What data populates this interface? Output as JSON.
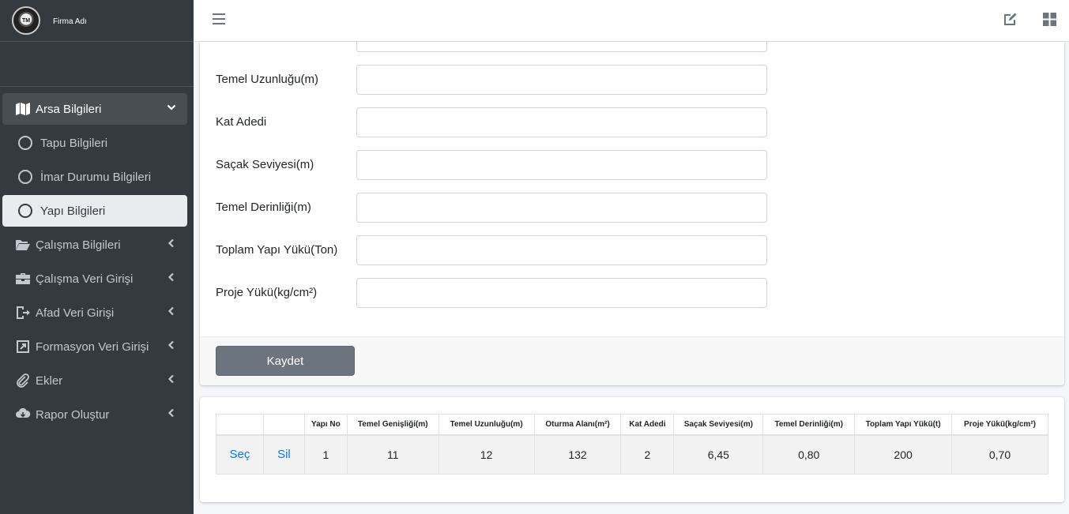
{
  "brand": {
    "name": "Firma Adı",
    "logo_text": "TM"
  },
  "sidebar": {
    "items": [
      {
        "label": "Arsa Bilgileri",
        "icon": "map-icon",
        "open": true
      },
      {
        "label": "Çalışma Bilgileri",
        "icon": "folder-open-icon"
      },
      {
        "label": "Çalışma Veri Girişi",
        "icon": "briefcase-icon"
      },
      {
        "label": "Afad Veri Girişi",
        "icon": "door-exit-icon"
      },
      {
        "label": "Formasyon Veri Girişi",
        "icon": "external-square-icon"
      },
      {
        "label": "Ekler",
        "icon": "paperclip-icon"
      },
      {
        "label": "Rapor Oluştur",
        "icon": "cloud-download-icon"
      }
    ],
    "subitems": [
      {
        "label": "Tapu Bilgileri"
      },
      {
        "label": "İmar Durumu Bilgileri"
      },
      {
        "label": "Yapı Bilgileri",
        "active": true
      }
    ]
  },
  "form": {
    "fields": [
      {
        "label": "Temel Uzunluğu(m)",
        "value": ""
      },
      {
        "label": "Kat Adedi",
        "value": ""
      },
      {
        "label": "Saçak Seviyesi(m)",
        "value": ""
      },
      {
        "label": "Temel Derinliği(m)",
        "value": ""
      },
      {
        "label": "Toplam Yapı Yükü(Ton)",
        "value": ""
      },
      {
        "label": "Proje Yükü(kg/cm²)",
        "value": ""
      }
    ],
    "save_label": "Kaydet"
  },
  "table": {
    "headers": [
      "",
      "",
      "Yapı No",
      "Temel Genişliği(m)",
      "Temel Uzunluğu(m)",
      "Oturma Alanı(m²)",
      "Kat Adedi",
      "Saçak Seviyesi(m)",
      "Temel Derinliği(m)",
      "Toplam Yapı Yükü(t)",
      "Proje Yükü(kg/cm²)"
    ],
    "rows": [
      [
        "Seç",
        "Sil",
        "1",
        "11",
        "12",
        "132",
        "2",
        "6,45",
        "0,80",
        "200",
        "0,70"
      ]
    ]
  }
}
